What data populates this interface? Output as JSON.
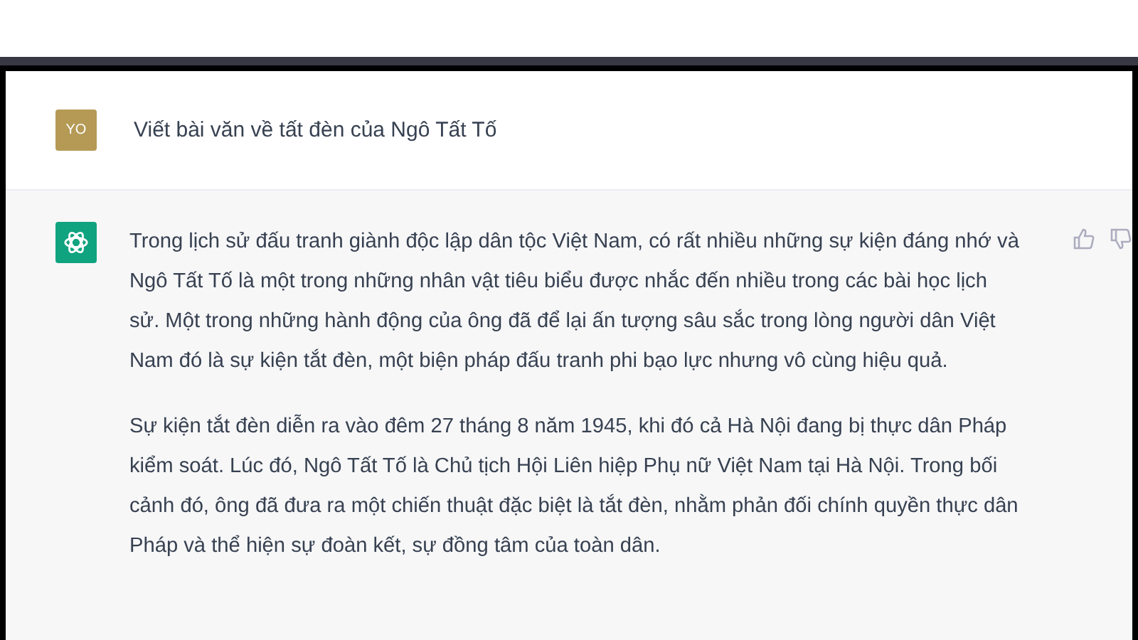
{
  "user_message": {
    "avatar": "YO",
    "text": "Viết bài văn về tất đèn của Ngô Tất Tố"
  },
  "assistant_message": {
    "paragraphs": [
      "Trong lịch sử đấu tranh giành độc lập dân tộc Việt Nam, có rất nhiều những sự kiện đáng nhớ và Ngô Tất Tố là một trong những nhân vật tiêu biểu được nhắc đến nhiều trong các bài học lịch sử. Một trong những hành động của ông đã để lại ấn tượng sâu sắc trong lòng người dân Việt Nam đó là sự kiện tắt đèn, một biện pháp đấu tranh phi bạo lực nhưng vô cùng hiệu quả.",
      "Sự kiện tắt đèn diễn ra vào đêm 27 tháng 8 năm 1945, khi đó cả Hà Nội đang bị thực dân Pháp kiểm soát. Lúc đó, Ngô Tất Tố là Chủ tịch Hội Liên hiệp Phụ nữ Việt Nam tại Hà Nội. Trong bối cảnh đó, ông đã đưa ra một chiến thuật đặc biệt là tắt đèn, nhằm phản đối chính quyền thực dân Pháp và thể hiện sự đoàn kết, sự đồng tâm của toàn dân."
    ]
  }
}
